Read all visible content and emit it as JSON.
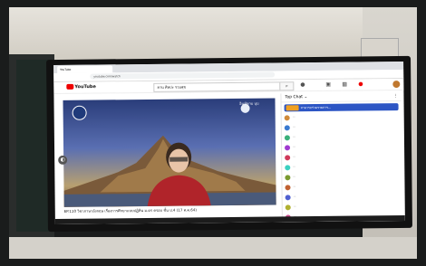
{
  "browser": {
    "tab_title": "YouTube",
    "address": "youtube.com/watch"
  },
  "youtube": {
    "logo_text": "YouTube",
    "search_value": "ลาน ศิลปะ รวมสุข",
    "video_overlay_title": "อินทัยกบ บุบ",
    "video_caption": "EP.110 วิชาภาษาอังกฤษ เรื่องการศึกษาแบบปฏิทิน ม.ดร ครอบ ชั้น ป.4 (17 ส.ค.64)"
  },
  "chat": {
    "header": "Top Chat",
    "pinned": "สามารถร่วมรายการ...",
    "messages": [
      {
        "text": "...",
        "color": "#d08a3a"
      },
      {
        "text": "...",
        "color": "#3a7ad0"
      },
      {
        "text": "...",
        "color": "#3ab07a"
      },
      {
        "text": "...",
        "color": "#a03ad0"
      },
      {
        "text": "...",
        "color": "#d03a5a"
      },
      {
        "text": "...",
        "color": "#3ad0c0"
      },
      {
        "text": "...",
        "color": "#7a9a30"
      },
      {
        "text": "...",
        "color": "#c06030"
      },
      {
        "text": "...",
        "color": "#5060d0"
      },
      {
        "text": "...",
        "color": "#b0b030"
      },
      {
        "text": "...",
        "color": "#d05090"
      }
    ]
  },
  "colors": {
    "youtube_red": "#ee0000",
    "chat_pinned": "#2c55c4"
  }
}
